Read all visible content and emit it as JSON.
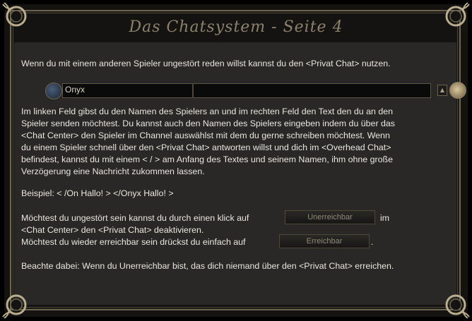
{
  "window": {
    "title": "Das Chatsystem - Seite 4"
  },
  "intro": "Wenn du mit einem anderen Spieler ungestört reden willst kannst du den <Privat Chat> nutzen.",
  "chatbar": {
    "name_value": "Onyx",
    "message_value": ""
  },
  "explanation_lines": [
    "Im linken Feld gibst du den Namen des Spielers an und im rechten Feld den Text den du an den",
    "Spieler senden möchtest. Du kannst auch den Namen des Spielers eingeben indem du über das",
    "<Chat Center> den Spieler im Channel auswählst mit dem du gerne schreiben möchtest. Wenn",
    "du einem Spieler schnell über den <Privat Chat> antworten willst und dich im <Overhead Chat>",
    "befindest, kannst du mit einem < / > am Anfang des Textes und seinem Namen, ihm ohne große",
    "Verzögerung eine Nachricht zukommen lassen."
  ],
  "example": "Beispiel: < /On Hallo! > </Onyx Hallo! >",
  "unreachable": {
    "line1_before": "Möchtest du ungestört sein kannst du durch einen klick auf",
    "button": "Unerreichbar",
    "line1_after": "im",
    "line2": "<Chat Center> den <Privat Chat> deaktivieren."
  },
  "reachable": {
    "line_before": "Möchtest du wieder erreichbar sein drückst du einfach auf",
    "button": "Erreichbar",
    "line_after": "."
  },
  "note": "Beachte dabei: Wenn du Unerreichbar bist, das dich niemand über den <Privat Chat> erreichen.",
  "colors": {
    "background": "#2a2826",
    "text": "#e9e6df",
    "title": "#8b826b",
    "border": "#6e6550"
  }
}
